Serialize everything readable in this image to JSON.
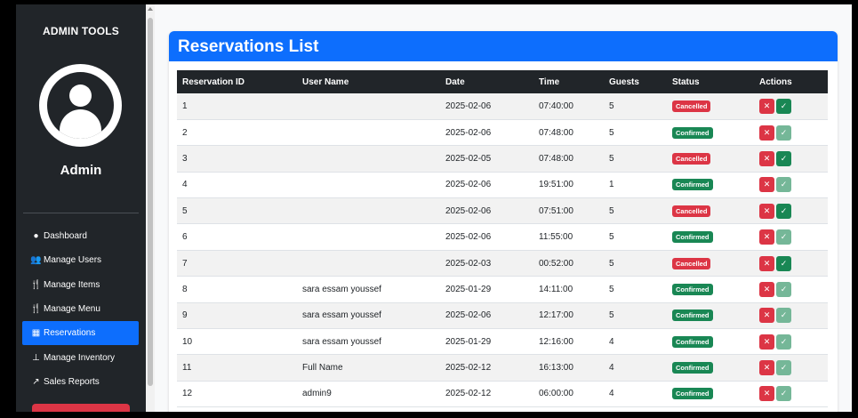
{
  "sidebar": {
    "title": "ADMIN TOOLS",
    "username": "Admin",
    "nav": [
      {
        "label": "Dashboard",
        "icon": "dashboard-icon",
        "glyph": "●"
      },
      {
        "label": "Manage Users",
        "icon": "users-icon",
        "glyph": "👥"
      },
      {
        "label": "Manage Items",
        "icon": "utensils-icon",
        "glyph": "🍴"
      },
      {
        "label": "Manage Menu",
        "icon": "utensils-icon",
        "glyph": "🍴"
      },
      {
        "label": "Reservations",
        "icon": "calendar-icon",
        "glyph": "▦"
      },
      {
        "label": "Manage Inventory",
        "icon": "sitemap-icon",
        "glyph": "⊥"
      },
      {
        "label": "Sales Reports",
        "icon": "chart-icon",
        "glyph": "↗"
      }
    ],
    "active": "Reservations"
  },
  "card": {
    "title": "Reservations List"
  },
  "table": {
    "headers": [
      "Reservation ID",
      "User Name",
      "Date",
      "Time",
      "Guests",
      "Status",
      "Actions"
    ],
    "rows": [
      {
        "id": "1",
        "user": "",
        "date": "2025-02-06",
        "time": "07:40:00",
        "guests": "5",
        "status": "Cancelled"
      },
      {
        "id": "2",
        "user": "",
        "date": "2025-02-06",
        "time": "07:48:00",
        "guests": "5",
        "status": "Confirmed"
      },
      {
        "id": "3",
        "user": "",
        "date": "2025-02-05",
        "time": "07:48:00",
        "guests": "5",
        "status": "Cancelled"
      },
      {
        "id": "4",
        "user": "",
        "date": "2025-02-06",
        "time": "19:51:00",
        "guests": "1",
        "status": "Confirmed"
      },
      {
        "id": "5",
        "user": "",
        "date": "2025-02-06",
        "time": "07:51:00",
        "guests": "5",
        "status": "Cancelled"
      },
      {
        "id": "6",
        "user": "",
        "date": "2025-02-06",
        "time": "11:55:00",
        "guests": "5",
        "status": "Confirmed"
      },
      {
        "id": "7",
        "user": "",
        "date": "2025-02-03",
        "time": "00:52:00",
        "guests": "5",
        "status": "Cancelled"
      },
      {
        "id": "8",
        "user": "sara essam youssef",
        "date": "2025-01-29",
        "time": "14:11:00",
        "guests": "5",
        "status": "Confirmed"
      },
      {
        "id": "9",
        "user": "sara essam youssef",
        "date": "2025-02-06",
        "time": "12:17:00",
        "guests": "5",
        "status": "Confirmed"
      },
      {
        "id": "10",
        "user": "sara essam youssef",
        "date": "2025-01-29",
        "time": "12:16:00",
        "guests": "4",
        "status": "Confirmed"
      },
      {
        "id": "11",
        "user": "Full Name",
        "date": "2025-02-12",
        "time": "16:13:00",
        "guests": "4",
        "status": "Confirmed"
      },
      {
        "id": "12",
        "user": "admin9",
        "date": "2025-02-12",
        "time": "06:00:00",
        "guests": "4",
        "status": "Confirmed"
      }
    ]
  },
  "actions": {
    "reject_glyph": "✕",
    "confirm_glyph": "✓"
  },
  "colors": {
    "primary": "#0d6efd",
    "danger": "#dc3545",
    "success": "#198754",
    "sidebar": "#212529"
  }
}
